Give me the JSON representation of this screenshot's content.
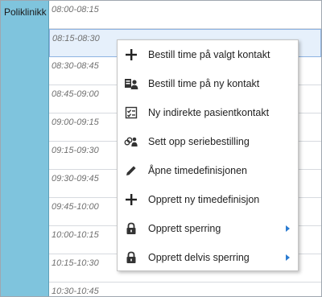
{
  "resource": {
    "label": "Poliklinikk"
  },
  "slots": [
    "08:00-08:15",
    "08:15-08:30",
    "08:30-08:45",
    "08:45-09:00",
    "09:00-09:15",
    "09:15-09:30",
    "09:30-09:45",
    "09:45-10:00",
    "10:00-10:15",
    "10:15-10:30",
    "10:30-10:45"
  ],
  "selected_slot": "08:15-08:30",
  "context_menu": {
    "items": [
      {
        "label": "Bestill time på valgt kontakt",
        "icon": "plus-icon"
      },
      {
        "label": "Bestill time på ny kontakt",
        "icon": "new-contact-icon"
      },
      {
        "label": "Ny indirekte pasientkontakt",
        "icon": "checklist-icon"
      },
      {
        "label": "Sett opp seriebestilling",
        "icon": "series-booking-icon"
      },
      {
        "label": "Åpne timedefinisjonen",
        "icon": "pencil-icon"
      },
      {
        "label": "Opprett ny timedefinisjon",
        "icon": "plus-icon"
      },
      {
        "label": "Opprett sperring",
        "icon": "lock-icon",
        "submenu": true
      },
      {
        "label": "Opprett delvis sperring",
        "icon": "lock-icon",
        "submenu": true
      }
    ]
  },
  "colors": {
    "resource_column": "#7fc4dd",
    "selected_slot": "#e6f0fb",
    "submenu_arrow": "#2a7bd1"
  }
}
